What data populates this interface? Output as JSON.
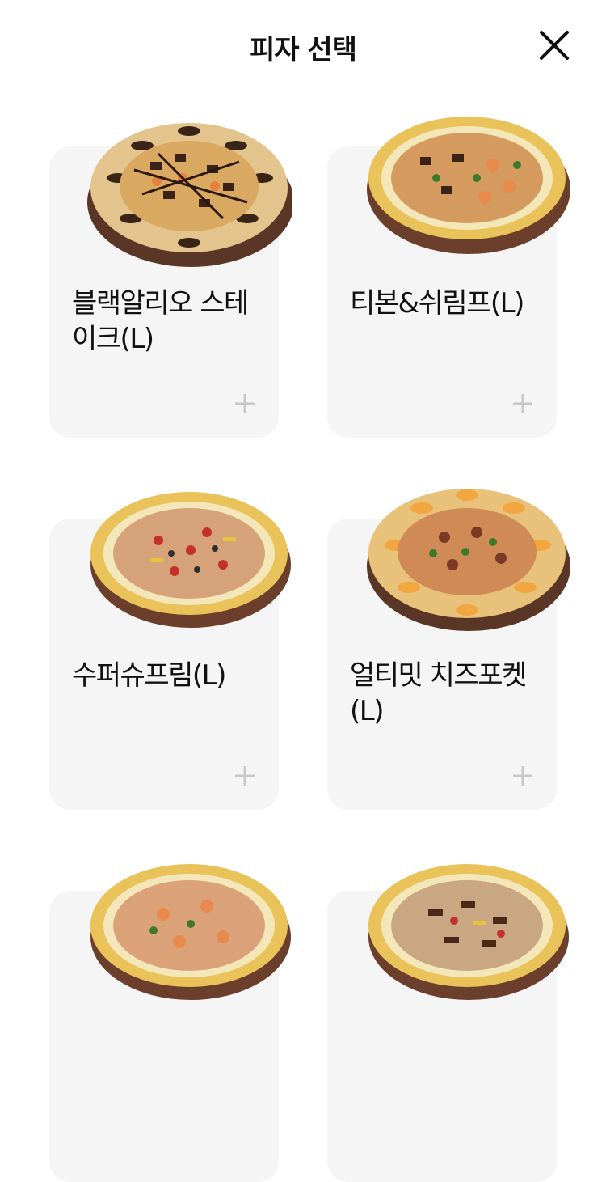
{
  "header": {
    "title": "피자 선택",
    "close_icon": "close-icon"
  },
  "pizzas": [
    {
      "name": "블랙알리오 스테이크(L)",
      "image": "pizza-black-alio-steak-image",
      "add_icon": "plus-icon",
      "style": "pocket-dark"
    },
    {
      "name": "티본&쉬림프(L)",
      "image": "pizza-tbone-shrimp-image",
      "add_icon": "plus-icon",
      "style": "round"
    },
    {
      "name": "수퍼슈프림(L)",
      "image": "pizza-super-supreme-image",
      "add_icon": "plus-icon",
      "style": "round"
    },
    {
      "name": "얼티밋 치즈포켓(L)",
      "image": "pizza-ultimate-cheese-pocket-image",
      "add_icon": "plus-icon",
      "style": "pocket-light"
    },
    {
      "name": "",
      "image": "pizza-shrimp-image",
      "add_icon": "plus-icon",
      "style": "round"
    },
    {
      "name": "",
      "image": "pizza-bulgogi-image",
      "add_icon": "plus-icon",
      "style": "round"
    }
  ],
  "colors": {
    "card_bg": "#f5f5f6",
    "plus": "#c8c8c8",
    "crust": "#e9c25a",
    "board": "#6b3f2c"
  }
}
